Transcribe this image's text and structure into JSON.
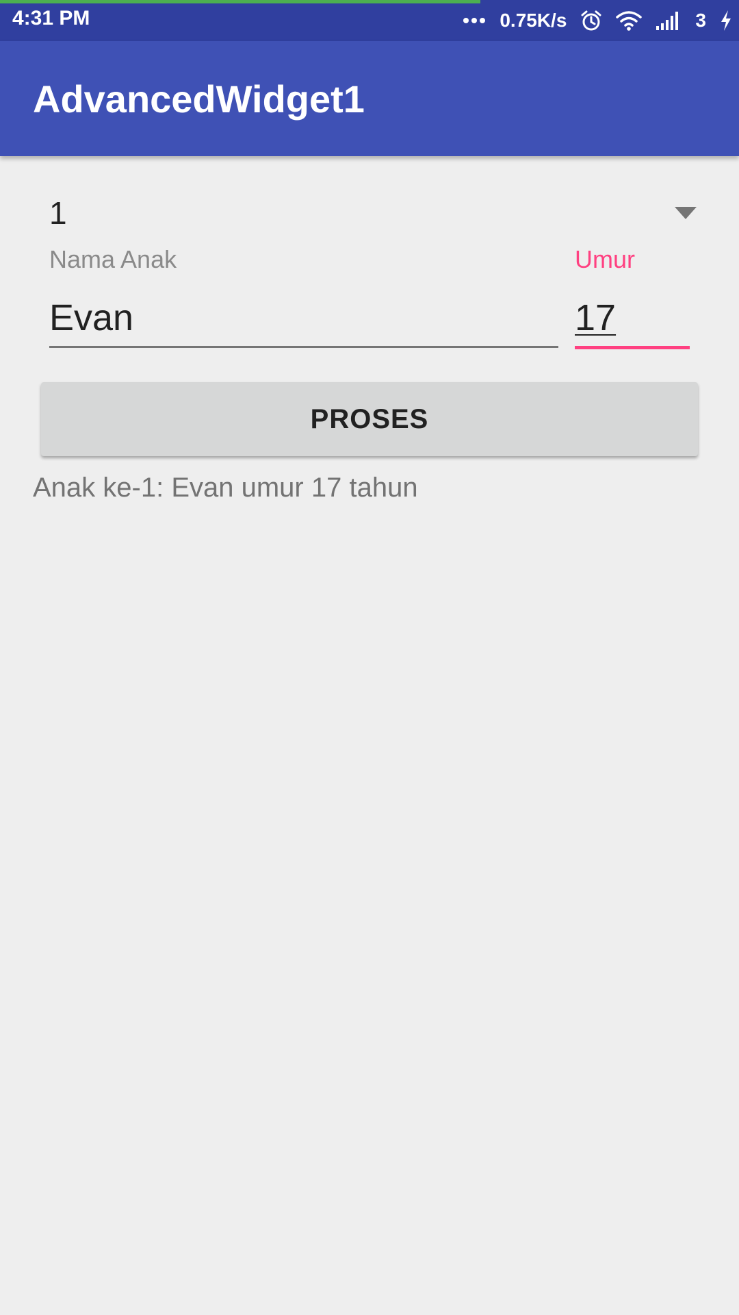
{
  "status_bar": {
    "time": "4:31 PM",
    "network_speed": "0.75K/s",
    "sim_label": "3",
    "icons": [
      "more-dots-icon",
      "alarm-icon",
      "wifi-icon",
      "signal-icon",
      "charging-icon"
    ],
    "load_progress": 0.65
  },
  "app_bar": {
    "title": "AdvancedWidget1"
  },
  "form": {
    "spinner_value": "1",
    "name_label": "Nama Anak",
    "name_value": "Evan",
    "age_label": "Umur",
    "age_value": "17",
    "button_label": "PROSES",
    "result_text": "Anak ke-1: Evan umur 17 tahun"
  },
  "colors": {
    "primary": "#3f51b5",
    "primary_dark": "#303f9f",
    "accent": "#ff4081",
    "background": "#eeeeee"
  }
}
